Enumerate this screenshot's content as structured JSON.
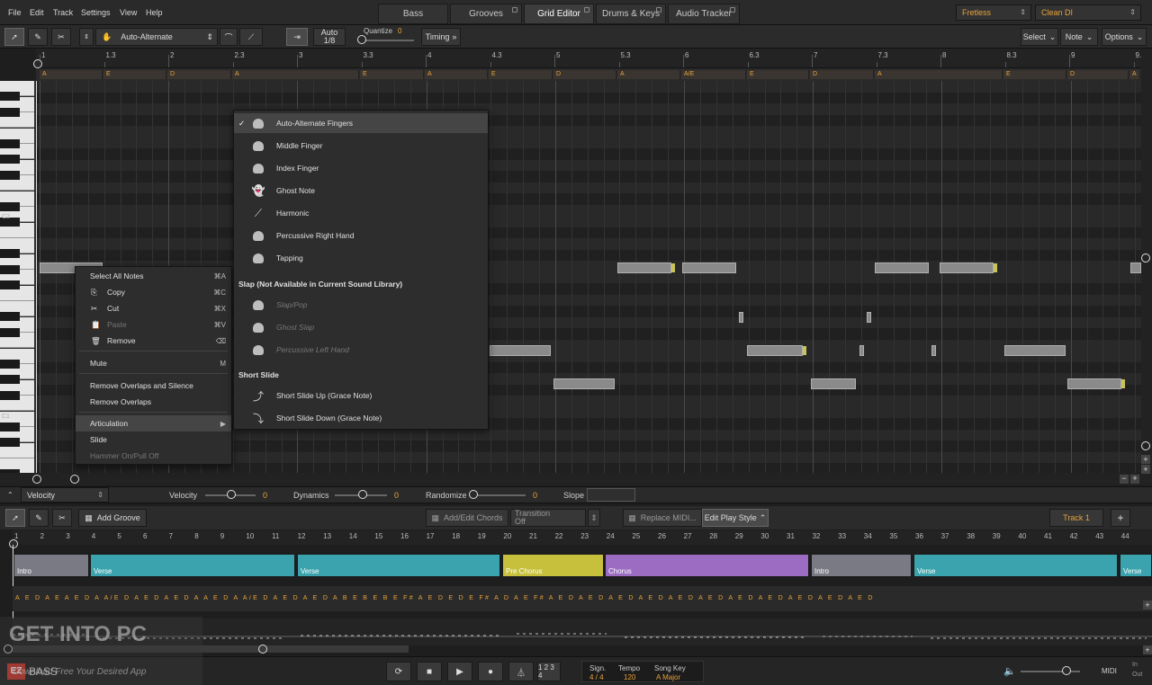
{
  "menubar": {
    "items": [
      "File",
      "Edit",
      "Track",
      "Settings",
      "View",
      "Help"
    ],
    "tabs": [
      "Bass",
      "Grooves",
      "Grid Editor",
      "Drums & Keys",
      "Audio Tracker"
    ],
    "active_tab": "Grid Editor",
    "instrument": "Fretless",
    "preset": "Clean DI"
  },
  "toolbar": {
    "articulation": "Auto-Alternate",
    "auto_label": "Auto",
    "auto_value": "1/8",
    "quantize_label": "Quantize",
    "quantize_value": "0",
    "timing_label": "Timing",
    "select_label": "Select",
    "note_label": "Note",
    "options_label": "Options"
  },
  "ruler": {
    "labels": [
      "1",
      "1.3",
      "2",
      "2.3",
      "3",
      "3.3",
      "4",
      "4.3",
      "5",
      "5.3",
      "6",
      "6.3",
      "7",
      "7.3",
      "8",
      "8.3",
      "9",
      "9.3"
    ]
  },
  "chords": [
    "A",
    "E",
    "D",
    "A",
    "E",
    "A",
    "E",
    "D",
    "A",
    "A/E",
    "E",
    "D",
    "A",
    "E",
    "D",
    "A"
  ],
  "keys": {
    "c2": "C2",
    "c1": "C1"
  },
  "context_menu": {
    "items": [
      {
        "label": "Select All Notes",
        "shortcut": "⌘A"
      },
      {
        "label": "Copy",
        "shortcut": "⌘C"
      },
      {
        "label": "Cut",
        "shortcut": "⌘X"
      },
      {
        "label": "Paste",
        "shortcut": "⌘V"
      },
      {
        "label": "Remove",
        "shortcut": "⌫"
      },
      {
        "label": "Mute",
        "shortcut": "M"
      },
      {
        "label": "Remove Overlaps and Silence",
        "shortcut": ""
      },
      {
        "label": "Remove Overlaps",
        "shortcut": ""
      },
      {
        "label": "Articulation",
        "shortcut": "▶"
      },
      {
        "label": "Slide",
        "shortcut": ""
      },
      {
        "label": "Hammer On/Pull Off",
        "shortcut": ""
      }
    ]
  },
  "articulation_menu": {
    "items": [
      "Auto-Alternate Fingers",
      "Middle Finger",
      "Index Finger",
      "Ghost Note",
      "Harmonic",
      "Percussive Right Hand",
      "Tapping"
    ],
    "slap_header": "Slap (Not Available in Current Sound Library)",
    "slap_items": [
      "Slap/Pop",
      "Ghost Slap",
      "Percussive Left Hand"
    ],
    "short_slide_header": "Short Slide",
    "short_slide_items": [
      "Short Slide Up (Grace Note)",
      "Short Slide Down (Grace Note)"
    ],
    "checkmark": "✓"
  },
  "automation": {
    "lane": "Velocity",
    "velocity_label": "Velocity",
    "velocity_value": "0",
    "dynamics_label": "Dynamics",
    "dynamics_value": "0",
    "randomize_label": "Randomize",
    "randomize_value": "0",
    "slope_label": "Slope"
  },
  "song": {
    "add_groove": "Add Groove",
    "add_edit_chords": "Add/Edit Chords",
    "transition_label": "Transition",
    "transition_value": "Off",
    "replace_midi": "Replace MIDI...",
    "edit_play_style": "Edit Play Style",
    "track_name": "Track 1",
    "add_track": "+",
    "bars": [
      "1",
      "2",
      "3",
      "4",
      "5",
      "6",
      "7",
      "8",
      "9",
      "10",
      "11",
      "12",
      "13",
      "14",
      "15",
      "16",
      "17",
      "18",
      "19",
      "20",
      "21",
      "22",
      "23",
      "24",
      "25",
      "26",
      "27",
      "28",
      "29",
      "30",
      "31",
      "32",
      "33",
      "34",
      "35",
      "36",
      "37",
      "38",
      "39",
      "40",
      "41",
      "42",
      "43",
      "44"
    ],
    "sections": [
      {
        "name": "Intro",
        "color": "#7a7a85"
      },
      {
        "name": "Verse",
        "color": "#3aa3ad"
      },
      {
        "name": "Verse",
        "color": "#3aa3ad"
      },
      {
        "name": "Pre Chorus",
        "color": "#c6c03c"
      },
      {
        "name": "Chorus",
        "color": "#9b6cc2"
      },
      {
        "name": "Intro",
        "color": "#7a7a85"
      },
      {
        "name": "Verse",
        "color": "#3aa3ad"
      },
      {
        "name": "Verse",
        "color": "#3aa3ad"
      }
    ],
    "chord_lane": "A E D A   E A E D A A/E D A   E D A   E D A A E D A A/E D A   E D A   E D A B E B E B E F# A E D   E D   E F# A   D   A   E F# A   E D A   E D A   E D A   E D A   E D A   E D A   E D A   E D A   E D A   E D A   E D"
  },
  "transport": {
    "brand": "EZ",
    "brand2": "BASS",
    "counter": "1 2 3 4",
    "sign_label": "Sign.",
    "sign_value": "4 / 4",
    "tempo_label": "Tempo",
    "tempo_value": "120",
    "key_label": "Song Key",
    "key_value": "A Major",
    "midi_label": "MIDI",
    "in_label": "In",
    "out_label": "Out"
  },
  "watermark": {
    "text": "GET INTO PC",
    "sub": "Download Free Your Desired App"
  },
  "colors": {
    "accent": "#e8a23a",
    "background": "#1e1e1e"
  }
}
